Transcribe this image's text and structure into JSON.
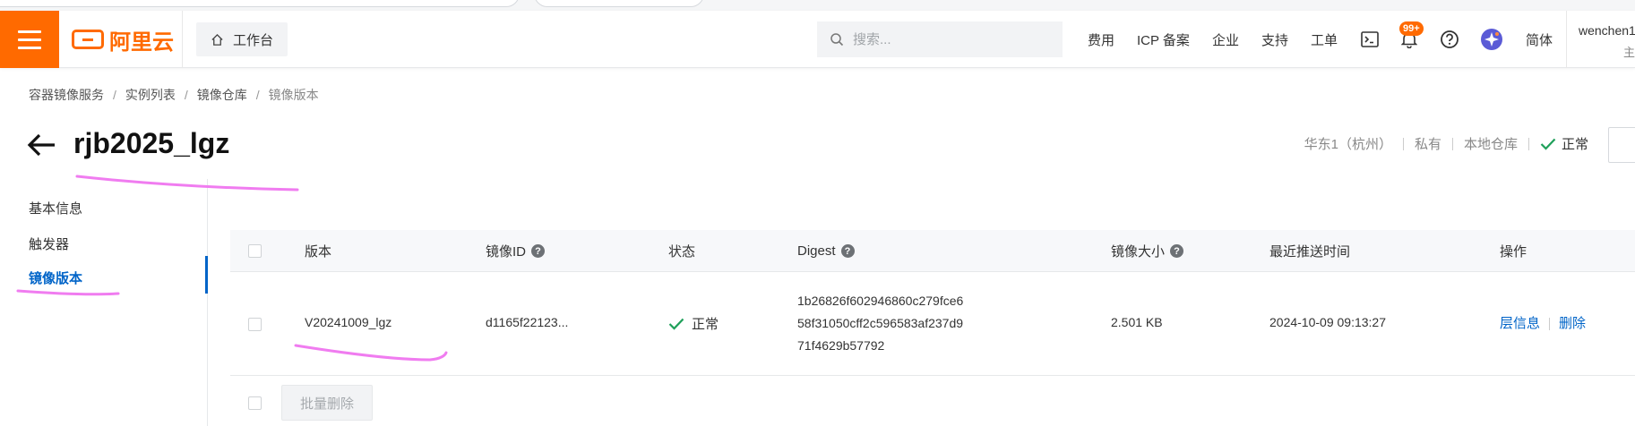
{
  "topbar": {
    "logo_text": "阿里云",
    "workbench_label": "工作台",
    "search_placeholder": "搜索...",
    "nav": {
      "fees": "费用",
      "icp": "ICP 备案",
      "enterprise": "企业",
      "support": "支持",
      "ticket": "工单",
      "lang": "简体"
    },
    "notification_badge": "99+",
    "username": "wenchen1",
    "user_sub": "主"
  },
  "breadcrumb": [
    "容器镜像服务",
    "实例列表",
    "镜像仓库",
    "镜像版本"
  ],
  "page": {
    "title": "rjb2025_lgz",
    "meta": {
      "region": "华东1（杭州）",
      "visibility": "私有",
      "source": "本地仓库",
      "status": "正常"
    }
  },
  "leftnav": {
    "items": [
      "基本信息",
      "触发器",
      "镜像版本"
    ],
    "active_index": 2
  },
  "table": {
    "headers": {
      "version": "版本",
      "image_id": "镜像ID",
      "status": "状态",
      "digest": "Digest",
      "size": "镜像大小",
      "pushed": "最近推送时间",
      "actions": "操作"
    },
    "rows": [
      {
        "version": "V20241009_lgz",
        "image_id": "d1165f22123...",
        "status": "正常",
        "digest_lines": [
          "1b26826f602946860c279fce6",
          "58f31050cff2c596583af237d9",
          "71f4629b57792"
        ],
        "size": "2.501 KB",
        "pushed": "2024-10-09 09:13:27",
        "action_layers": "层信息",
        "action_delete": "删除"
      }
    ],
    "batch_delete": "批量删除"
  },
  "colors": {
    "brand": "#ff6a00",
    "link": "#0064c8",
    "ok": "#1fa05a",
    "annotation": "#f07cf0"
  }
}
